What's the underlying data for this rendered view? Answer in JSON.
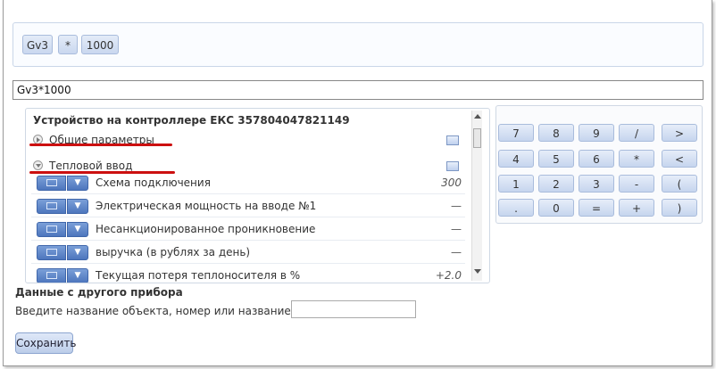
{
  "tokens": [
    "Gv3",
    "*",
    "1000"
  ],
  "formula": {
    "value": "Gv3*1000"
  },
  "tree": {
    "title": "Устройство на контроллере ЕКС 357804047821149",
    "groups": [
      {
        "label": "Общие параметры",
        "state": "collapsed"
      },
      {
        "label": "Тепловой ввод",
        "state": "expanded"
      }
    ],
    "params": [
      {
        "label": "Схема подключения",
        "value": "300"
      },
      {
        "label": "Электрическая мощность на вводе №1",
        "value": "—"
      },
      {
        "label": "Несанкционированное проникновение",
        "value": "—"
      },
      {
        "label": "выручка (в рублях за день)",
        "value": "—"
      },
      {
        "label": "Текущая потеря теплоносителя в %",
        "value": "+2.0"
      }
    ]
  },
  "calculator": {
    "keys": [
      [
        "7",
        "8",
        "9",
        "/",
        ">"
      ],
      [
        "4",
        "5",
        "6",
        "*",
        "<"
      ],
      [
        "1",
        "2",
        "3",
        "-",
        "("
      ],
      [
        ".",
        "0",
        "=",
        "+",
        ")"
      ]
    ]
  },
  "other_device": {
    "title": "Данные с другого прибора",
    "label": "Введите название объекта, номер или название прибора",
    "value": ""
  },
  "save_label": "Сохранить",
  "colors": {
    "highlight_underline": "#cc1010",
    "accent_blue": "#4d76bd"
  },
  "icons": {
    "group_toggle": "circle-arrow-icon",
    "chart": "chart-icon",
    "dropdown": "chevron-down-icon"
  }
}
